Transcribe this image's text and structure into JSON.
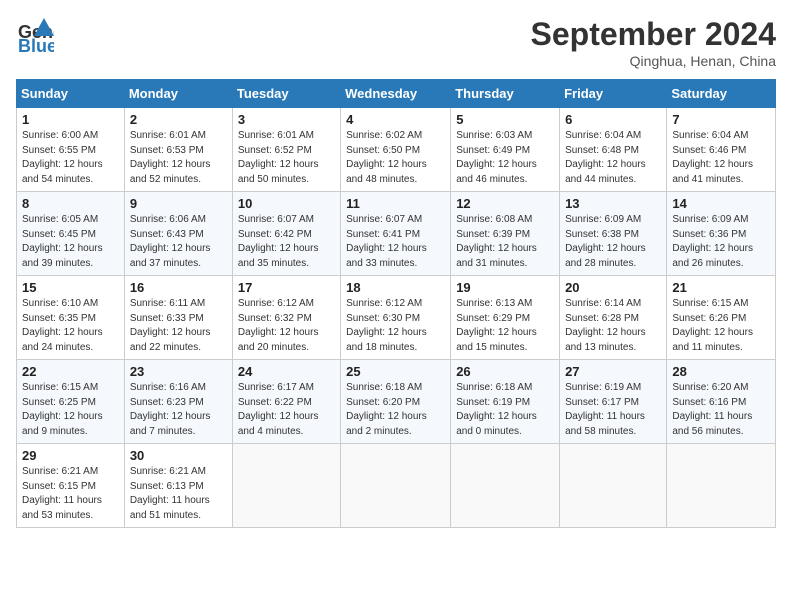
{
  "header": {
    "logo_line1": "General",
    "logo_line2": "Blue",
    "month": "September 2024",
    "location": "Qinghua, Henan, China"
  },
  "weekdays": [
    "Sunday",
    "Monday",
    "Tuesday",
    "Wednesday",
    "Thursday",
    "Friday",
    "Saturday"
  ],
  "weeks": [
    [
      {
        "day": "1",
        "info": "Sunrise: 6:00 AM\nSunset: 6:55 PM\nDaylight: 12 hours\nand 54 minutes."
      },
      {
        "day": "2",
        "info": "Sunrise: 6:01 AM\nSunset: 6:53 PM\nDaylight: 12 hours\nand 52 minutes."
      },
      {
        "day": "3",
        "info": "Sunrise: 6:01 AM\nSunset: 6:52 PM\nDaylight: 12 hours\nand 50 minutes."
      },
      {
        "day": "4",
        "info": "Sunrise: 6:02 AM\nSunset: 6:50 PM\nDaylight: 12 hours\nand 48 minutes."
      },
      {
        "day": "5",
        "info": "Sunrise: 6:03 AM\nSunset: 6:49 PM\nDaylight: 12 hours\nand 46 minutes."
      },
      {
        "day": "6",
        "info": "Sunrise: 6:04 AM\nSunset: 6:48 PM\nDaylight: 12 hours\nand 44 minutes."
      },
      {
        "day": "7",
        "info": "Sunrise: 6:04 AM\nSunset: 6:46 PM\nDaylight: 12 hours\nand 41 minutes."
      }
    ],
    [
      {
        "day": "8",
        "info": "Sunrise: 6:05 AM\nSunset: 6:45 PM\nDaylight: 12 hours\nand 39 minutes."
      },
      {
        "day": "9",
        "info": "Sunrise: 6:06 AM\nSunset: 6:43 PM\nDaylight: 12 hours\nand 37 minutes."
      },
      {
        "day": "10",
        "info": "Sunrise: 6:07 AM\nSunset: 6:42 PM\nDaylight: 12 hours\nand 35 minutes."
      },
      {
        "day": "11",
        "info": "Sunrise: 6:07 AM\nSunset: 6:41 PM\nDaylight: 12 hours\nand 33 minutes."
      },
      {
        "day": "12",
        "info": "Sunrise: 6:08 AM\nSunset: 6:39 PM\nDaylight: 12 hours\nand 31 minutes."
      },
      {
        "day": "13",
        "info": "Sunrise: 6:09 AM\nSunset: 6:38 PM\nDaylight: 12 hours\nand 28 minutes."
      },
      {
        "day": "14",
        "info": "Sunrise: 6:09 AM\nSunset: 6:36 PM\nDaylight: 12 hours\nand 26 minutes."
      }
    ],
    [
      {
        "day": "15",
        "info": "Sunrise: 6:10 AM\nSunset: 6:35 PM\nDaylight: 12 hours\nand 24 minutes."
      },
      {
        "day": "16",
        "info": "Sunrise: 6:11 AM\nSunset: 6:33 PM\nDaylight: 12 hours\nand 22 minutes."
      },
      {
        "day": "17",
        "info": "Sunrise: 6:12 AM\nSunset: 6:32 PM\nDaylight: 12 hours\nand 20 minutes."
      },
      {
        "day": "18",
        "info": "Sunrise: 6:12 AM\nSunset: 6:30 PM\nDaylight: 12 hours\nand 18 minutes."
      },
      {
        "day": "19",
        "info": "Sunrise: 6:13 AM\nSunset: 6:29 PM\nDaylight: 12 hours\nand 15 minutes."
      },
      {
        "day": "20",
        "info": "Sunrise: 6:14 AM\nSunset: 6:28 PM\nDaylight: 12 hours\nand 13 minutes."
      },
      {
        "day": "21",
        "info": "Sunrise: 6:15 AM\nSunset: 6:26 PM\nDaylight: 12 hours\nand 11 minutes."
      }
    ],
    [
      {
        "day": "22",
        "info": "Sunrise: 6:15 AM\nSunset: 6:25 PM\nDaylight: 12 hours\nand 9 minutes."
      },
      {
        "day": "23",
        "info": "Sunrise: 6:16 AM\nSunset: 6:23 PM\nDaylight: 12 hours\nand 7 minutes."
      },
      {
        "day": "24",
        "info": "Sunrise: 6:17 AM\nSunset: 6:22 PM\nDaylight: 12 hours\nand 4 minutes."
      },
      {
        "day": "25",
        "info": "Sunrise: 6:18 AM\nSunset: 6:20 PM\nDaylight: 12 hours\nand 2 minutes."
      },
      {
        "day": "26",
        "info": "Sunrise: 6:18 AM\nSunset: 6:19 PM\nDaylight: 12 hours\nand 0 minutes."
      },
      {
        "day": "27",
        "info": "Sunrise: 6:19 AM\nSunset: 6:17 PM\nDaylight: 11 hours\nand 58 minutes."
      },
      {
        "day": "28",
        "info": "Sunrise: 6:20 AM\nSunset: 6:16 PM\nDaylight: 11 hours\nand 56 minutes."
      }
    ],
    [
      {
        "day": "29",
        "info": "Sunrise: 6:21 AM\nSunset: 6:15 PM\nDaylight: 11 hours\nand 53 minutes."
      },
      {
        "day": "30",
        "info": "Sunrise: 6:21 AM\nSunset: 6:13 PM\nDaylight: 11 hours\nand 51 minutes."
      },
      null,
      null,
      null,
      null,
      null
    ]
  ]
}
